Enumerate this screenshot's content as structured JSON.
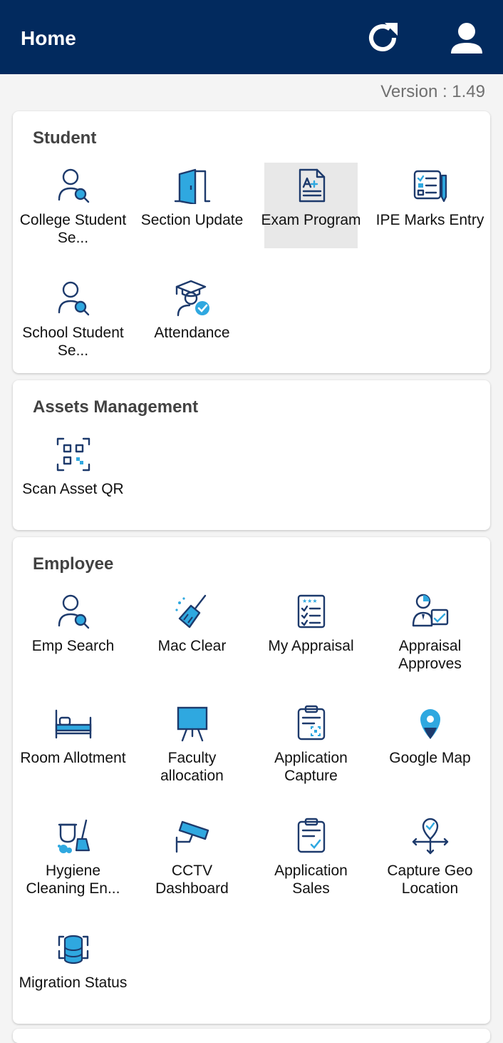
{
  "header": {
    "title": "Home"
  },
  "version_text": "Version : 1.49",
  "sections": {
    "student": {
      "title": "Student",
      "items": [
        {
          "label": "College Student Se...",
          "icon": "user-search-icon"
        },
        {
          "label": "Section Update",
          "icon": "door-icon"
        },
        {
          "label": "Exam Program",
          "icon": "grade-document-icon",
          "selected": true
        },
        {
          "label": "IPE Marks Entry",
          "icon": "checklist-pen-icon"
        },
        {
          "label": "School Student Se...",
          "icon": "user-search-icon"
        },
        {
          "label": "Attendance",
          "icon": "graduate-check-icon"
        }
      ]
    },
    "assets": {
      "title": "Assets Management",
      "items": [
        {
          "label": "Scan Asset QR",
          "icon": "qr-scan-icon"
        }
      ]
    },
    "employee": {
      "title": "Employee",
      "items": [
        {
          "label": "Emp Search",
          "icon": "user-search-icon"
        },
        {
          "label": "Mac Clear",
          "icon": "broom-icon"
        },
        {
          "label": "My Appraisal",
          "icon": "rating-checklist-icon"
        },
        {
          "label": "Appraisal Approves",
          "icon": "manager-approval-icon"
        },
        {
          "label": "Room Allotment",
          "icon": "bed-icon"
        },
        {
          "label": "Faculty allocation",
          "icon": "presentation-board-icon"
        },
        {
          "label": "Application Capture",
          "icon": "clipboard-scan-icon"
        },
        {
          "label": "Google Map",
          "icon": "map-pin-icon"
        },
        {
          "label": "Hygiene Cleaning En...",
          "icon": "cleaning-icon"
        },
        {
          "label": "CCTV Dashboard",
          "icon": "cctv-camera-icon"
        },
        {
          "label": "Application Sales",
          "icon": "clipboard-check-icon"
        },
        {
          "label": "Capture Geo Location",
          "icon": "geo-location-icon"
        },
        {
          "label": "Migration Status",
          "icon": "database-sync-icon"
        }
      ]
    }
  },
  "colors": {
    "appbar": "#022a5e",
    "icon_stroke": "#1d3a6c",
    "icon_accent": "#2fa8e0"
  }
}
